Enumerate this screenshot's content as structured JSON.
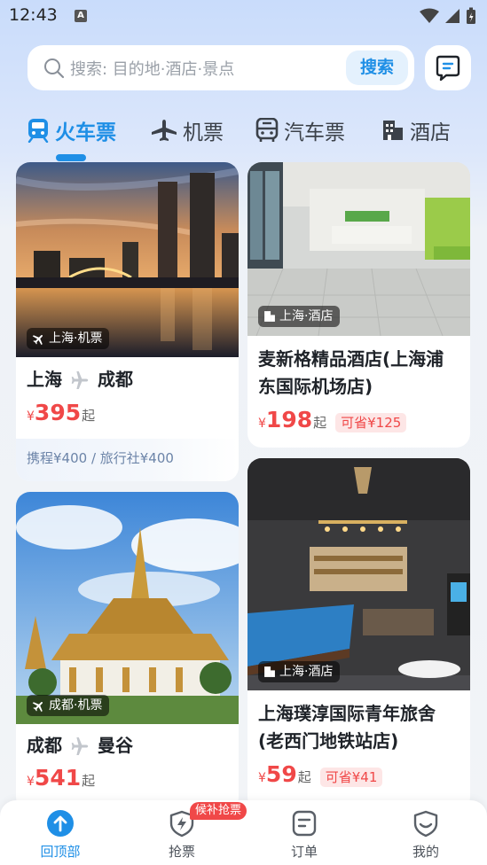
{
  "status_bar": {
    "time": "12:43",
    "notification_glyph": "A"
  },
  "search": {
    "placeholder": "搜索: 目的地·酒店·景点",
    "button_label": "搜索"
  },
  "tabs": [
    {
      "label": "火车票",
      "icon": "train-icon",
      "active": true
    },
    {
      "label": "机票",
      "icon": "plane-icon",
      "active": false
    },
    {
      "label": "汽车票",
      "icon": "bus-icon",
      "active": false
    },
    {
      "label": "酒店",
      "icon": "hotel-icon",
      "active": false
    }
  ],
  "cards": {
    "flight_shanghai_chengdu": {
      "tag": "上海·机票",
      "from": "上海",
      "to": "成都",
      "price": "395",
      "currency": "¥",
      "price_suffix": "起",
      "compare": "携程¥400 / 旅行社¥400"
    },
    "hotel_mxg": {
      "tag": "上海·酒店",
      "title_line1": "麦新格精品酒店(上海浦",
      "title_line2": "东国际机场店)",
      "price": "198",
      "currency": "¥",
      "price_suffix": "起",
      "save": "可省¥125"
    },
    "flight_chengdu_bangkok": {
      "tag": "成都·机票",
      "from": "成都",
      "to": "曼谷",
      "price": "541",
      "currency": "¥",
      "price_suffix": "起"
    },
    "hotel_pc": {
      "tag": "上海·酒店",
      "title_line1": "上海璞淳国际青年旅舍",
      "title_line2": "(老西门地铁站店)",
      "price": "59",
      "currency": "¥",
      "price_suffix": "起",
      "save": "可省¥41"
    }
  },
  "bottom_nav": {
    "items": [
      {
        "label": "回顶部",
        "icon": "arrow-up-icon",
        "active": true
      },
      {
        "label": "抢票",
        "icon": "lightning-shield-icon",
        "active": false
      },
      {
        "label": "订单",
        "icon": "order-list-icon",
        "active": false
      },
      {
        "label": "我的",
        "icon": "profile-shield-icon",
        "active": false
      }
    ],
    "badge": "候补抢票"
  },
  "colors": {
    "accent": "#1f8fe6",
    "price": "#f04848"
  }
}
